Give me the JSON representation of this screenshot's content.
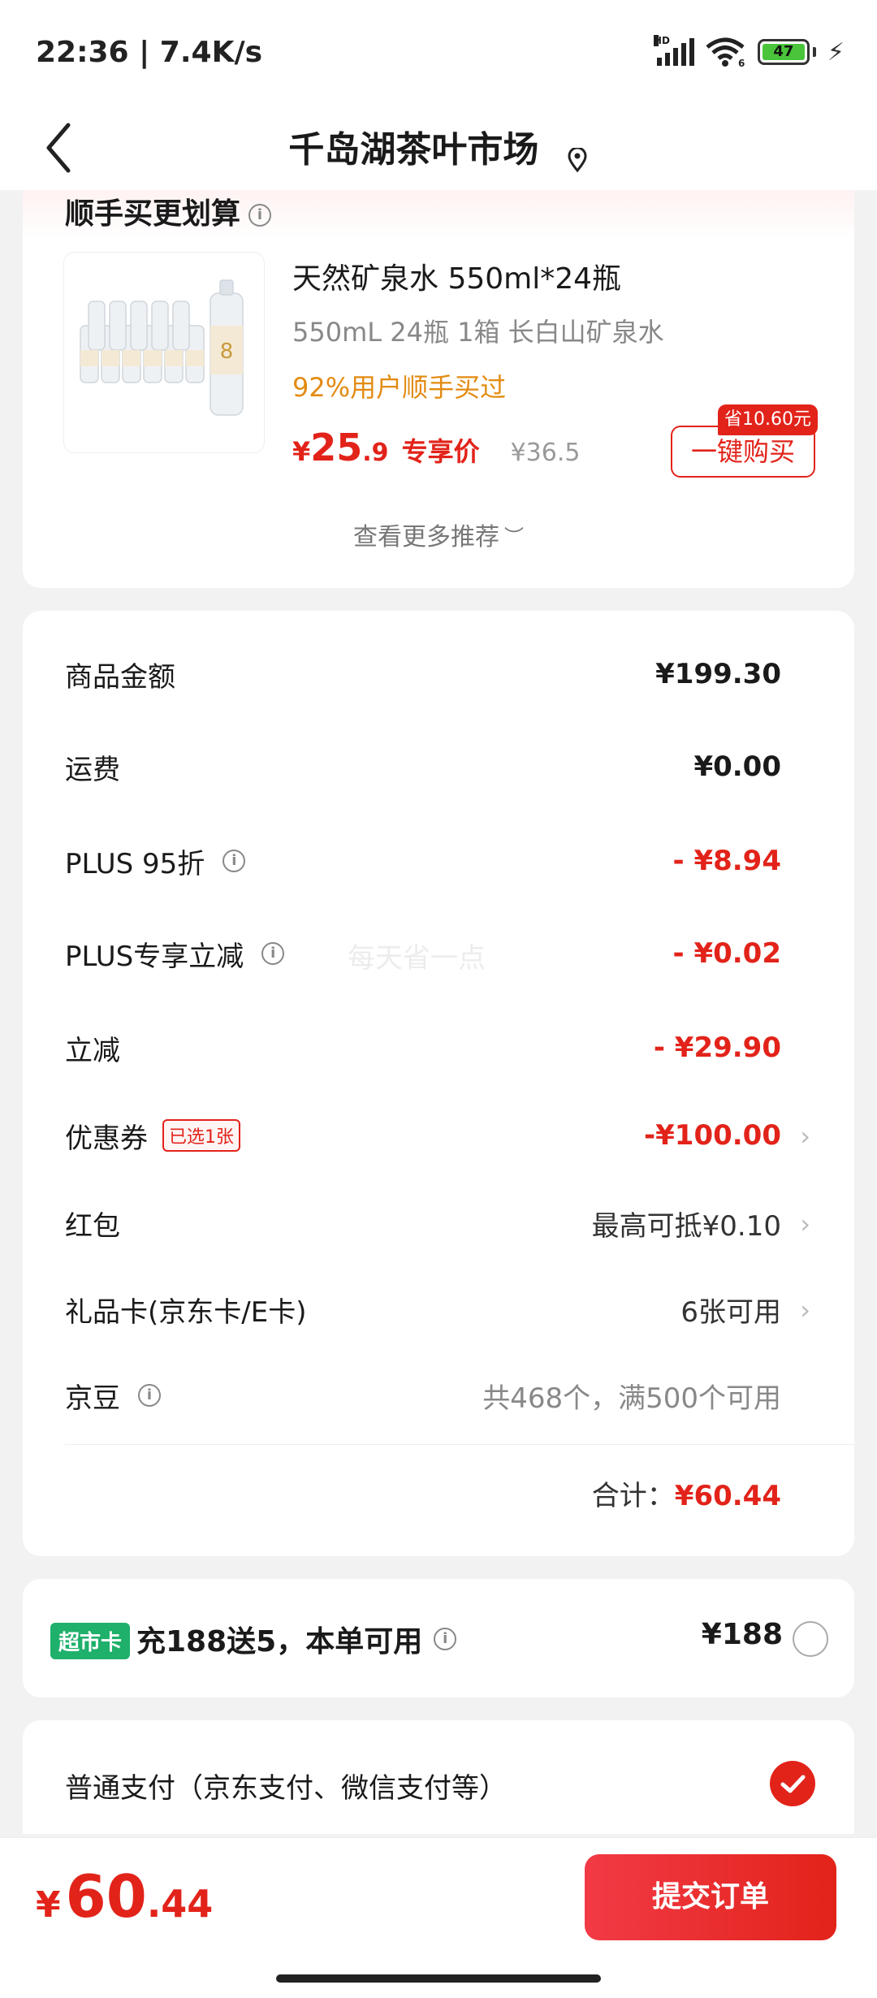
{
  "status_bar": {
    "time": "22:36 | 7.4K/s",
    "network_badge": "HD",
    "wifi_badge": "6",
    "battery_level": "47",
    "icons": [
      "signal-icon",
      "wifi-icon",
      "battery-icon",
      "charging-icon"
    ]
  },
  "nav": {
    "title": "千岛湖茶叶市场",
    "icons": [
      "back-icon",
      "location-icon"
    ]
  },
  "recommend": {
    "title": "顺手买更划算",
    "product": {
      "image_label": "8",
      "name": "天然矿泉水 550ml*24瓶",
      "spec": "550mL 24瓶 1箱 长白山矿泉水",
      "tip": "92%用户顺手买过",
      "price_yen": "¥",
      "price_int": "25",
      "price_dec": ".9",
      "price_label": "专享价",
      "original_price": "¥36.5",
      "save_badge": "省10.60元",
      "buy_label": "一键购买"
    },
    "more_label": "查看更多推荐"
  },
  "summary": {
    "rows": [
      {
        "label": "商品金额",
        "value": "¥199.30"
      },
      {
        "label": "运费",
        "value": "¥0.00"
      },
      {
        "label": "PLUS 95折",
        "value": "- ¥8.94"
      },
      {
        "label": "PLUS专享立减",
        "value": "- ¥0.02"
      },
      {
        "label": "立减",
        "value": "- ¥29.90"
      },
      {
        "label": "优惠券",
        "tag": "已选1张",
        "value": "-¥100.00"
      },
      {
        "label": "红包",
        "value": "最高可抵¥0.10"
      },
      {
        "label": "礼品卡(京东卡/E卡)",
        "value": "6张可用"
      },
      {
        "label": "京豆",
        "value": "共468个，满500个可用"
      }
    ],
    "watermark": "每天省一点",
    "total_label": "合计：",
    "total_value": "¥60.44"
  },
  "supermarket": {
    "tag": "超市卡",
    "text": "充188送5，本单可用",
    "price": "¥188"
  },
  "payment": {
    "label": "普通支付（京东支付、微信支付等）",
    "selected": true
  },
  "bottom": {
    "yen": "¥",
    "price_int": "60",
    "price_dec": ".44",
    "submit_label": "提交订单"
  },
  "colors": {
    "accent_red": "#e2231a",
    "tip_orange": "#e38b12",
    "supermarket_green": "#1fb06b"
  }
}
